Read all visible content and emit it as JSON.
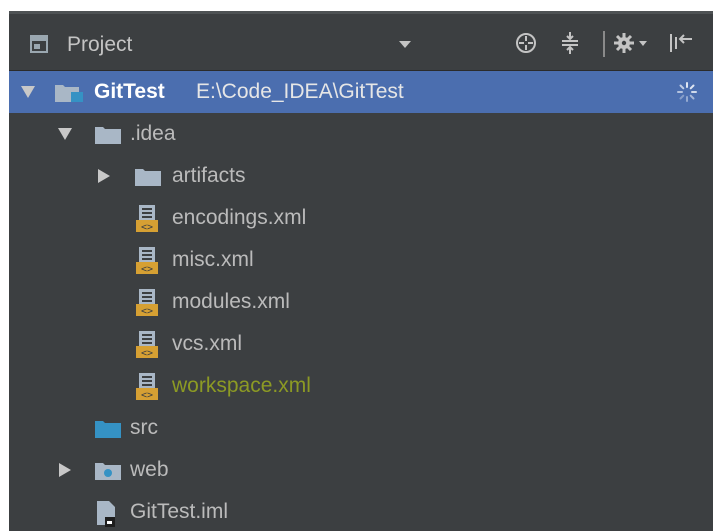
{
  "toolbar": {
    "title": "Project",
    "dropdown_icon": "caret-down-icon",
    "actions": [
      "crosshair-icon",
      "collapse-all-icon",
      "gear-icon",
      "hide-panel-icon"
    ]
  },
  "tree": {
    "root": {
      "label": "GitTest",
      "path": "E:\\Code_IDEA\\GitTest",
      "expanded": true,
      "status_icon": "loading-spinner-icon"
    },
    "idea": {
      "label": ".idea",
      "expanded": true
    },
    "artifacts": {
      "label": "artifacts",
      "expanded": false
    },
    "files": [
      {
        "label": "encodings.xml"
      },
      {
        "label": "misc.xml"
      },
      {
        "label": "modules.xml"
      },
      {
        "label": "vcs.xml"
      },
      {
        "label": "workspace.xml",
        "modified": true
      }
    ],
    "src": {
      "label": "src"
    },
    "web": {
      "label": "web",
      "expanded": false
    },
    "iml": {
      "label": "GitTest.iml"
    }
  },
  "colors": {
    "panel_bg": "#3c3f41",
    "selection": "#4b6eaf",
    "text": "#bbbbbb",
    "modified_text": "#8c9a24",
    "folder": "#a9b7c6",
    "source_folder": "#3592c4",
    "xml_icon": "#d6a033"
  }
}
